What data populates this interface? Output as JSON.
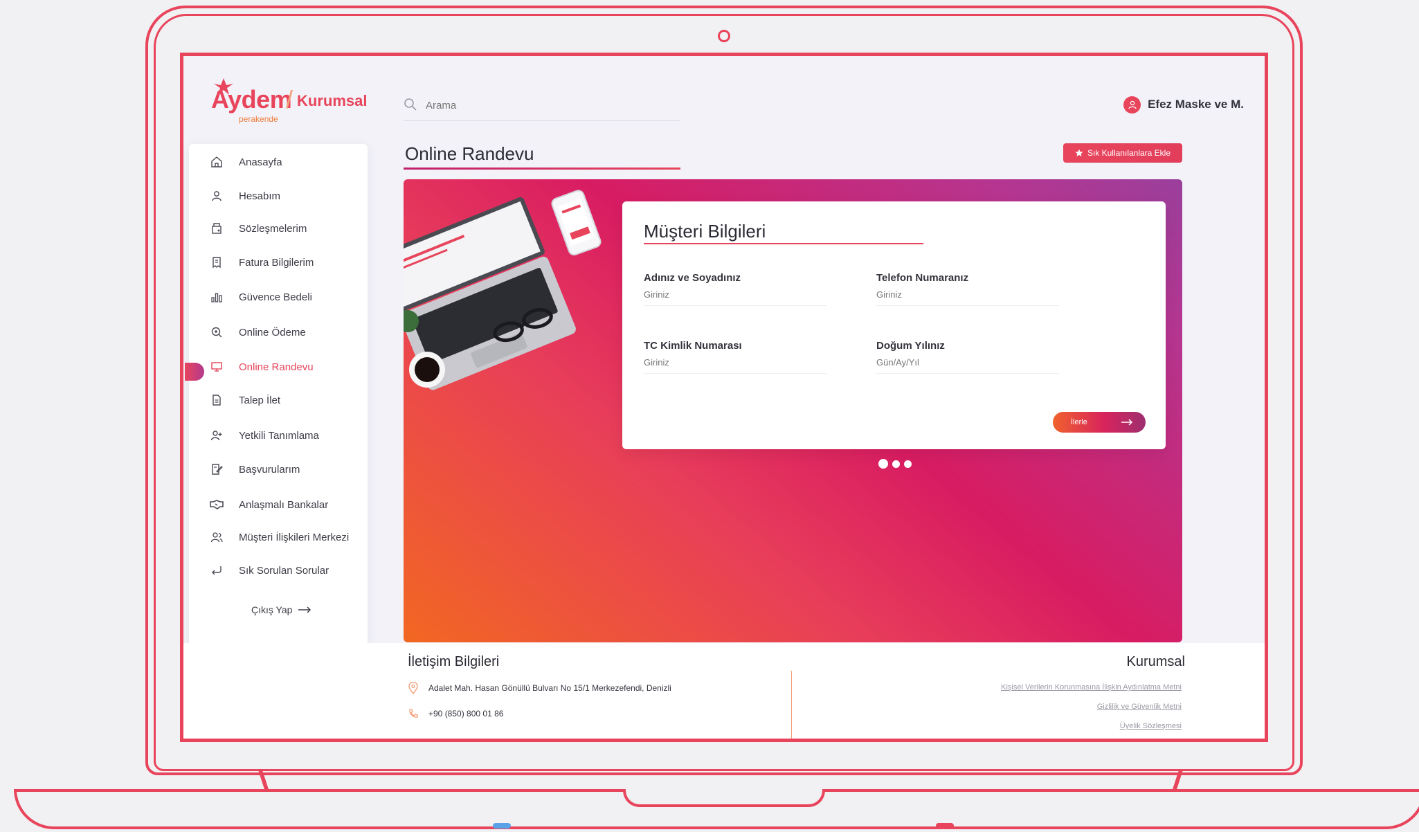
{
  "brand": {
    "name": "Aydem",
    "division": "Kurumsal",
    "sub": "perakende",
    "accent": "#e8455c"
  },
  "search": {
    "placeholder": "Arama"
  },
  "user": {
    "name": "Efez Maske ve M."
  },
  "sidebar": {
    "items": [
      {
        "label": "Anasayfa",
        "icon": "home-icon"
      },
      {
        "label": "Hesabım",
        "icon": "user-icon"
      },
      {
        "label": "Sözleşmelerim",
        "icon": "contract-icon"
      },
      {
        "label": "Fatura Bilgilerim",
        "icon": "invoice-icon"
      },
      {
        "label": "Güvence Bedeli",
        "icon": "bar-chart-icon"
      },
      {
        "label": "Online Ödeme",
        "icon": "payment-search-icon"
      },
      {
        "label": "Online Randevu",
        "icon": "monitor-icon",
        "active": true
      },
      {
        "label": "Talep İlet",
        "icon": "document-icon"
      },
      {
        "label": "Yetkili Tanımlama",
        "icon": "user-add-icon"
      },
      {
        "label": "Başvurularım",
        "icon": "application-icon"
      },
      {
        "label": "Anlaşmalı Bankalar",
        "icon": "handshake-icon"
      },
      {
        "label": "Müşteri İlişkileri Merkezi",
        "icon": "users-icon"
      },
      {
        "label": "Sık Sorulan Sorular",
        "icon": "return-icon"
      }
    ],
    "logout_label": "Çıkış Yap"
  },
  "main": {
    "title": "Online Randevu",
    "fav_label": "Sık Kullanılanlara Ekle",
    "form": {
      "title": "Müşteri Bilgileri",
      "fields": [
        {
          "label": "Adınız ve Soyadınız",
          "placeholder": "Giriniz"
        },
        {
          "label": "Telefon Numaranız",
          "placeholder": "Giriniz"
        },
        {
          "label": "TC Kimlik Numarası",
          "placeholder": "Giriniz"
        },
        {
          "label": "Doğum Yılınız",
          "placeholder": "Gün/Ay/Yıl"
        }
      ],
      "next_label": "İlerle"
    },
    "carousel": {
      "count": 3,
      "active_index": 0
    }
  },
  "footer": {
    "contact_title": "İletişim Bilgileri",
    "address": "Adalet Mah. Hasan Gönüllü Bulvarı No 15/1 Merkezefendi, Denizli",
    "phone": "+90 (850) 800 01 86",
    "corporate_title": "Kurumsal",
    "links": [
      "Kişisel Verilerin Korunmasına İlişkin Aydınlatma Metni",
      "Gizlilik ve Güvenlik Metni",
      "Üyelik Sözleşmesi"
    ]
  }
}
